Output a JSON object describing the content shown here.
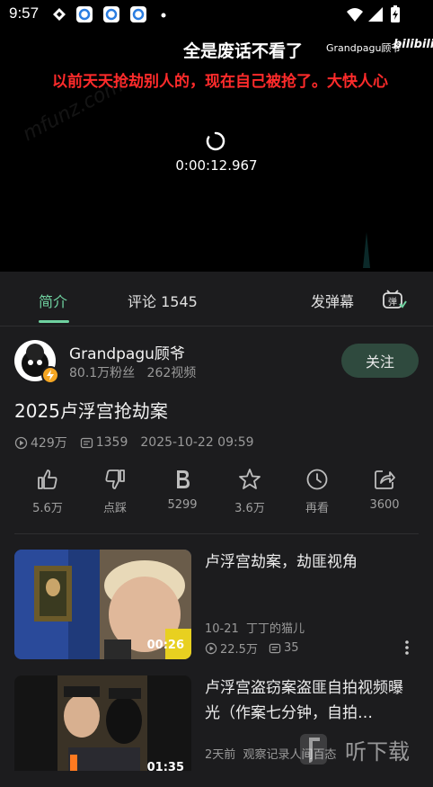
{
  "status_bar": {
    "time": "9:57"
  },
  "player": {
    "overlay_title": "全是废话不看了",
    "uploader_watermark": "Grandpagu顾爷",
    "logo_text": "bilibili",
    "danmaku": "以前天天抢劫别人的，现在自己被抢了。大快人心",
    "timecode": "0:00:12.967",
    "site_watermark": "mfunz.com"
  },
  "tabs": {
    "intro": "简介",
    "comments": "评论 1545",
    "send_danmaku": "发弹幕",
    "danmaku_toggle": "弹"
  },
  "uploader": {
    "name": "Grandpagu顾爷",
    "fans": "80.1万粉丝",
    "videos": "262视频",
    "follow_label": "关注"
  },
  "video": {
    "title": "2025卢浮宫抢劫案",
    "views": "429万",
    "danmaku_count": "1359",
    "date": "2025-10-22 09:59"
  },
  "actions": [
    {
      "icon": "like-icon",
      "label": "5.6万"
    },
    {
      "icon": "dislike-icon",
      "label": "点踩"
    },
    {
      "icon": "coin-icon",
      "label": "5299"
    },
    {
      "icon": "star-icon",
      "label": "3.6万"
    },
    {
      "icon": "clock-icon",
      "label": "再看"
    },
    {
      "icon": "share-icon",
      "label": "3600"
    }
  ],
  "recommendations": [
    {
      "title": "卢浮宫劫案，劫匪视角",
      "date": "10-21",
      "author": "丁丁的猫儿",
      "views": "22.5万",
      "danmaku": "35",
      "duration": "00:26"
    },
    {
      "title": "卢浮宫盗窃案盗匪自拍视频曝光（作案七分钟，自拍…",
      "date": "2天前",
      "author": "观察记录人间百态",
      "duration": "01:35"
    }
  ],
  "bottom_watermark": "听下载",
  "colors": {
    "accent": "#6fd2a0",
    "danmaku_red": "#ff2b2b",
    "background": "#1c1c1e",
    "follow_bg": "#2f4a3e"
  }
}
